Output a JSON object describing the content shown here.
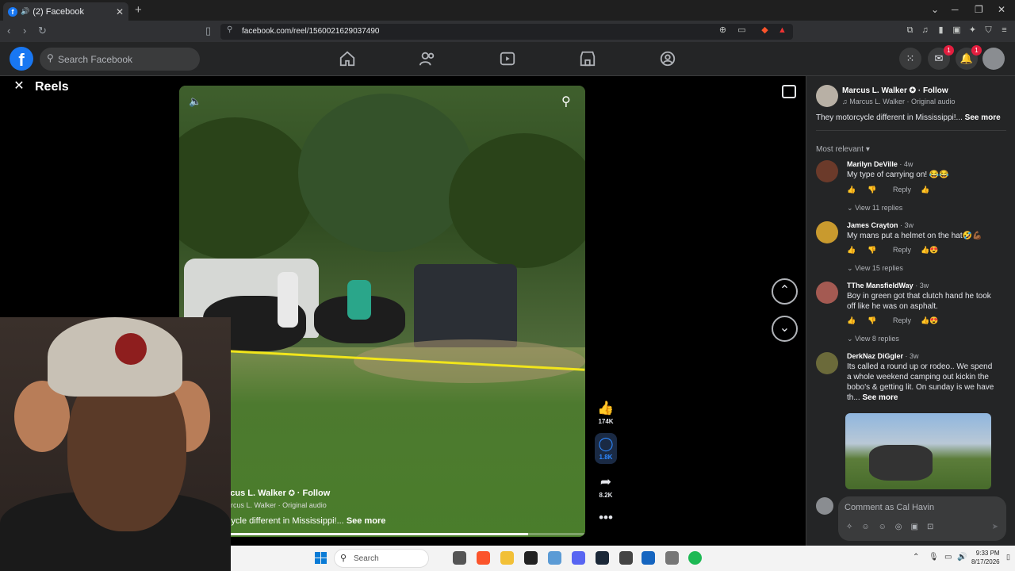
{
  "browser": {
    "tab_title": "(2) Facebook",
    "url": "facebook.com/reel/1560021629037490",
    "new_tab": "+"
  },
  "fb": {
    "logo": "f",
    "search_placeholder": "Search Facebook",
    "nav_icons": [
      "home-icon",
      "friends-icon",
      "video-icon",
      "marketplace-icon",
      "groups-icon"
    ],
    "messenger_badge": "1",
    "notifications_badge": "1"
  },
  "reels": {
    "title": "Reels",
    "video": {
      "author": "Marcus L. Walker",
      "follow": "· Follow",
      "audio": "Marcus L. Walker · Original audio",
      "caption": "They motorcycle different in Mississippi!...",
      "see_more": "See more",
      "progress": 0.86,
      "visible_author": "rcus L. Walker",
      "visible_audio": "arcus L. Walker · Original audio",
      "visible_caption": "cycle different in Mississippi!..."
    },
    "actions": {
      "likes": "174K",
      "comments": "1.8K",
      "shares": "8.2K"
    }
  },
  "panel": {
    "author": "Marcus L. Walker",
    "follow": "· Follow",
    "audio": "Marcus L. Walker · Original audio",
    "caption": "They motorcycle different in Mississippi!...",
    "see_more": "See more",
    "sort": "Most relevant",
    "comments": [
      {
        "name": "Marilyn DeVille",
        "time": "· 4w",
        "text": "My type of carrying on! 😂😂",
        "reply": "Reply",
        "view_replies": "View 11 replies",
        "avatar_color": "#6b3a2a"
      },
      {
        "name": "James Crayton",
        "time": "· 3w",
        "text": "My mans put a helmet on the hat🤣💪🏾",
        "reply": "Reply",
        "view_replies": "View 15 replies",
        "avatar_color": "#c99a2e"
      },
      {
        "name": "TThe MansfieldWay",
        "time": "· 3w",
        "text": "Boy in green got that clutch hand he took off like he was on asphalt.",
        "reply": "Reply",
        "view_replies": "View 8 replies",
        "avatar_color": "#a45a52"
      },
      {
        "name": "DerkNaz DiGgler",
        "time": "· 3w",
        "text": "Its called a round up or rodeo.. We spend a whole weekend camping out kickin the bobo's & getting lit. On sunday is we have th...",
        "see_more": "See more",
        "avatar_color": "#6b6a3a"
      }
    ],
    "input_placeholder": "Comment as Cal Havin"
  },
  "taskbar": {
    "search": "Search",
    "time": "9:33 PM",
    "date": "8/17/2026"
  }
}
